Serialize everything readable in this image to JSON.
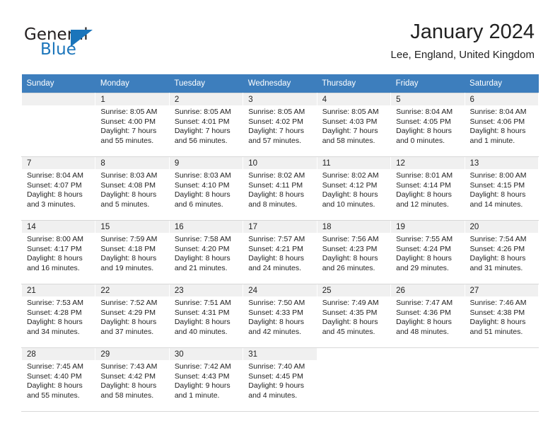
{
  "brand": {
    "name_top": "General",
    "name_bottom": "Blue",
    "accent_color": "#1b75bb",
    "triangle_icon": "triangle-icon"
  },
  "header": {
    "title": "January 2024",
    "subtitle": "Lee, England, United Kingdom"
  },
  "calendar": {
    "header_bg": "#3d7ebd",
    "daynum_bg": "#f0f0f0",
    "weekday_headers": [
      "Sunday",
      "Monday",
      "Tuesday",
      "Wednesday",
      "Thursday",
      "Friday",
      "Saturday"
    ],
    "weeks": [
      [
        {
          "day": "",
          "lines": []
        },
        {
          "day": "1",
          "lines": [
            "Sunrise: 8:05 AM",
            "Sunset: 4:00 PM",
            "Daylight: 7 hours",
            "and 55 minutes."
          ]
        },
        {
          "day": "2",
          "lines": [
            "Sunrise: 8:05 AM",
            "Sunset: 4:01 PM",
            "Daylight: 7 hours",
            "and 56 minutes."
          ]
        },
        {
          "day": "3",
          "lines": [
            "Sunrise: 8:05 AM",
            "Sunset: 4:02 PM",
            "Daylight: 7 hours",
            "and 57 minutes."
          ]
        },
        {
          "day": "4",
          "lines": [
            "Sunrise: 8:05 AM",
            "Sunset: 4:03 PM",
            "Daylight: 7 hours",
            "and 58 minutes."
          ]
        },
        {
          "day": "5",
          "lines": [
            "Sunrise: 8:04 AM",
            "Sunset: 4:05 PM",
            "Daylight: 8 hours",
            "and 0 minutes."
          ]
        },
        {
          "day": "6",
          "lines": [
            "Sunrise: 8:04 AM",
            "Sunset: 4:06 PM",
            "Daylight: 8 hours",
            "and 1 minute."
          ]
        }
      ],
      [
        {
          "day": "7",
          "lines": [
            "Sunrise: 8:04 AM",
            "Sunset: 4:07 PM",
            "Daylight: 8 hours",
            "and 3 minutes."
          ]
        },
        {
          "day": "8",
          "lines": [
            "Sunrise: 8:03 AM",
            "Sunset: 4:08 PM",
            "Daylight: 8 hours",
            "and 5 minutes."
          ]
        },
        {
          "day": "9",
          "lines": [
            "Sunrise: 8:03 AM",
            "Sunset: 4:10 PM",
            "Daylight: 8 hours",
            "and 6 minutes."
          ]
        },
        {
          "day": "10",
          "lines": [
            "Sunrise: 8:02 AM",
            "Sunset: 4:11 PM",
            "Daylight: 8 hours",
            "and 8 minutes."
          ]
        },
        {
          "day": "11",
          "lines": [
            "Sunrise: 8:02 AM",
            "Sunset: 4:12 PM",
            "Daylight: 8 hours",
            "and 10 minutes."
          ]
        },
        {
          "day": "12",
          "lines": [
            "Sunrise: 8:01 AM",
            "Sunset: 4:14 PM",
            "Daylight: 8 hours",
            "and 12 minutes."
          ]
        },
        {
          "day": "13",
          "lines": [
            "Sunrise: 8:00 AM",
            "Sunset: 4:15 PM",
            "Daylight: 8 hours",
            "and 14 minutes."
          ]
        }
      ],
      [
        {
          "day": "14",
          "lines": [
            "Sunrise: 8:00 AM",
            "Sunset: 4:17 PM",
            "Daylight: 8 hours",
            "and 16 minutes."
          ]
        },
        {
          "day": "15",
          "lines": [
            "Sunrise: 7:59 AM",
            "Sunset: 4:18 PM",
            "Daylight: 8 hours",
            "and 19 minutes."
          ]
        },
        {
          "day": "16",
          "lines": [
            "Sunrise: 7:58 AM",
            "Sunset: 4:20 PM",
            "Daylight: 8 hours",
            "and 21 minutes."
          ]
        },
        {
          "day": "17",
          "lines": [
            "Sunrise: 7:57 AM",
            "Sunset: 4:21 PM",
            "Daylight: 8 hours",
            "and 24 minutes."
          ]
        },
        {
          "day": "18",
          "lines": [
            "Sunrise: 7:56 AM",
            "Sunset: 4:23 PM",
            "Daylight: 8 hours",
            "and 26 minutes."
          ]
        },
        {
          "day": "19",
          "lines": [
            "Sunrise: 7:55 AM",
            "Sunset: 4:24 PM",
            "Daylight: 8 hours",
            "and 29 minutes."
          ]
        },
        {
          "day": "20",
          "lines": [
            "Sunrise: 7:54 AM",
            "Sunset: 4:26 PM",
            "Daylight: 8 hours",
            "and 31 minutes."
          ]
        }
      ],
      [
        {
          "day": "21",
          "lines": [
            "Sunrise: 7:53 AM",
            "Sunset: 4:28 PM",
            "Daylight: 8 hours",
            "and 34 minutes."
          ]
        },
        {
          "day": "22",
          "lines": [
            "Sunrise: 7:52 AM",
            "Sunset: 4:29 PM",
            "Daylight: 8 hours",
            "and 37 minutes."
          ]
        },
        {
          "day": "23",
          "lines": [
            "Sunrise: 7:51 AM",
            "Sunset: 4:31 PM",
            "Daylight: 8 hours",
            "and 40 minutes."
          ]
        },
        {
          "day": "24",
          "lines": [
            "Sunrise: 7:50 AM",
            "Sunset: 4:33 PM",
            "Daylight: 8 hours",
            "and 42 minutes."
          ]
        },
        {
          "day": "25",
          "lines": [
            "Sunrise: 7:49 AM",
            "Sunset: 4:35 PM",
            "Daylight: 8 hours",
            "and 45 minutes."
          ]
        },
        {
          "day": "26",
          "lines": [
            "Sunrise: 7:47 AM",
            "Sunset: 4:36 PM",
            "Daylight: 8 hours",
            "and 48 minutes."
          ]
        },
        {
          "day": "27",
          "lines": [
            "Sunrise: 7:46 AM",
            "Sunset: 4:38 PM",
            "Daylight: 8 hours",
            "and 51 minutes."
          ]
        }
      ],
      [
        {
          "day": "28",
          "lines": [
            "Sunrise: 7:45 AM",
            "Sunset: 4:40 PM",
            "Daylight: 8 hours",
            "and 55 minutes."
          ]
        },
        {
          "day": "29",
          "lines": [
            "Sunrise: 7:43 AM",
            "Sunset: 4:42 PM",
            "Daylight: 8 hours",
            "and 58 minutes."
          ]
        },
        {
          "day": "30",
          "lines": [
            "Sunrise: 7:42 AM",
            "Sunset: 4:43 PM",
            "Daylight: 9 hours",
            "and 1 minute."
          ]
        },
        {
          "day": "31",
          "lines": [
            "Sunrise: 7:40 AM",
            "Sunset: 4:45 PM",
            "Daylight: 9 hours",
            "and 4 minutes."
          ]
        },
        {
          "day": "",
          "lines": []
        },
        {
          "day": "",
          "lines": []
        },
        {
          "day": "",
          "lines": []
        }
      ]
    ]
  }
}
